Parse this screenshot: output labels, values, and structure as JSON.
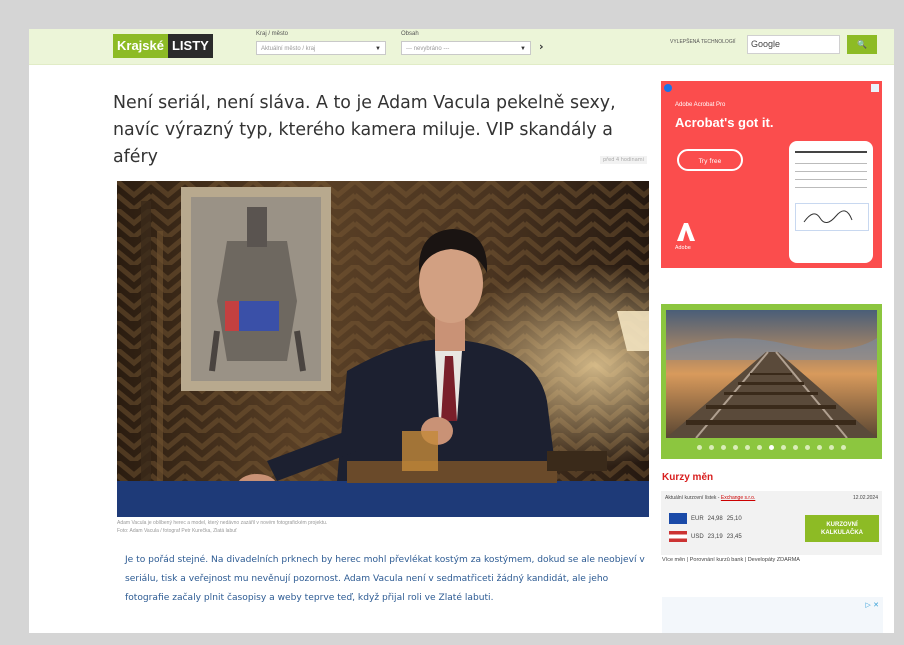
{
  "header": {
    "logo_part1": "Krajské",
    "logo_part2": "LISTY",
    "region_label": "Kraj / město",
    "region_value": "Aktuální město / kraj",
    "section_label": "Obsah",
    "section_value": "--- nevybráno ---",
    "google_label": "VYLEPŠENÁ TECHNOLOGIÍ",
    "search_value": "Google",
    "search_button": "🔍"
  },
  "article": {
    "headline": "Není seriál, není sláva. A to je Adam Vacula pekelně sexy, navíc výrazný typ, kterého kamera miluje. VIP skandály a aféry",
    "date_badge": "před 4 hodinami",
    "caption_line1": "Adam Vacula je oblíbený herec a model, který nedávno zazářil v novém fotografickém projektu.",
    "caption_line2": "Foto: Adam Vacula / fotograf Petr Kurečka, Zlatá labuť",
    "perex": "Je to pořád stejné. Na divadelních prknech by herec mohl převlékat kostým za kostýmem, dokud se ale neobjeví v seriálu, tisk a veřejnost mu nevěnují pozornost. Adam Vacula není v sedmatřiceti žádný kandidát, ale jeho fotografie začaly plnit časopisy a weby teprve teď, když přijal roli ve Zlaté labuti."
  },
  "ad_adobe": {
    "brand": "Adobe Acrobat Pro",
    "headline": "Acrobat's got it.",
    "cta": "Try free",
    "logo_text": "Adobe",
    "brand_color": "#fb4d4d"
  },
  "slider": {
    "dot_count": 13,
    "active_dot": 6
  },
  "kurzy": {
    "title": "Kurzy měn",
    "head_text": "Aktuální kurzovní lístek - ",
    "source": "Exchange s.r.o.",
    "date": "12.02.2024",
    "rates": [
      {
        "code": "EUR",
        "buy": "24,98",
        "sell": "25,10"
      },
      {
        "code": "USD",
        "buy": "23,19",
        "sell": "23,45"
      }
    ],
    "button": "KURZOVNÍ KALKULAČKA",
    "footer": "Více měn | Porovnání kurzů bank | Developáty ZDARMA"
  },
  "ad_bottom": {
    "marker": "▷ ✕"
  }
}
